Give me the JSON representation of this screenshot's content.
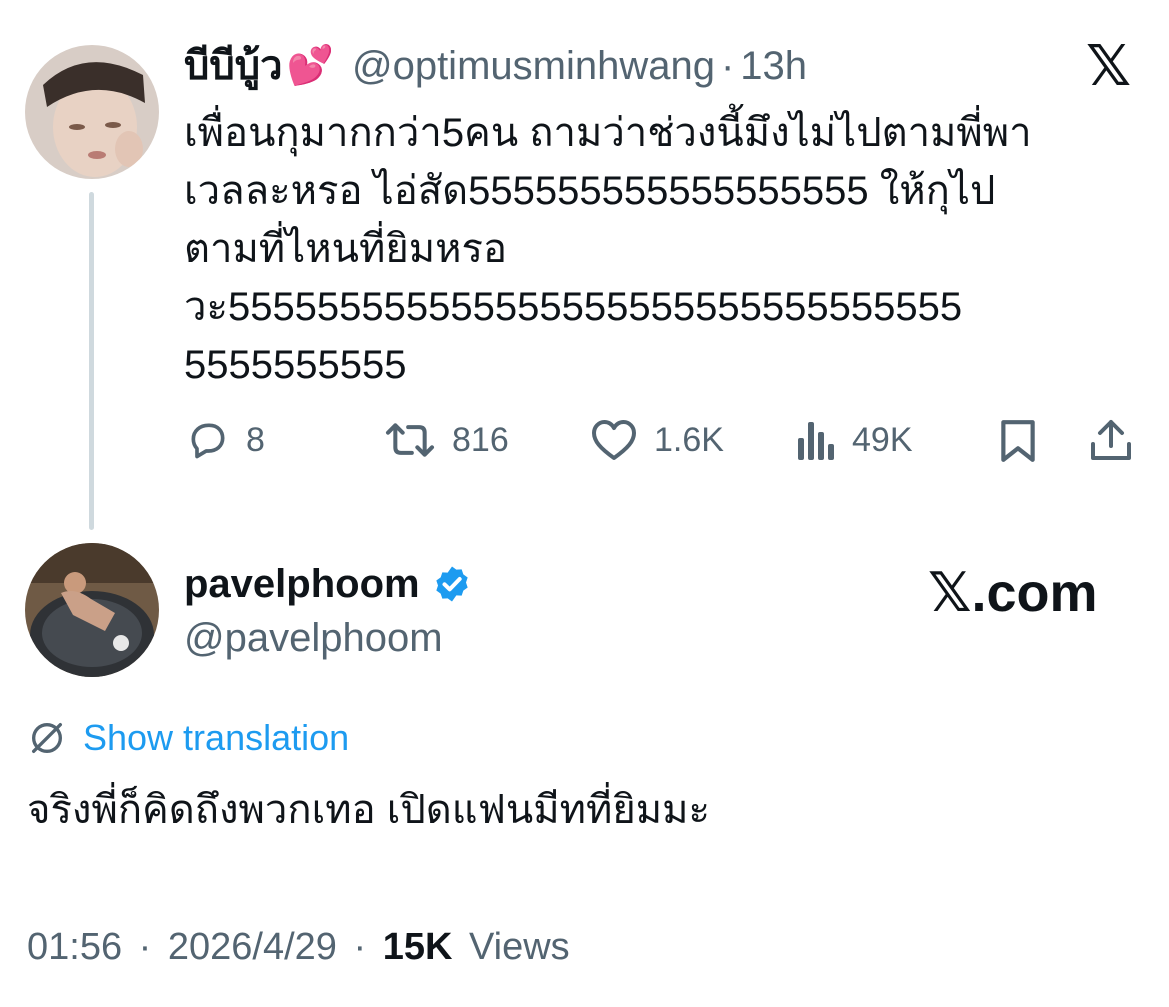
{
  "quoted_tweet": {
    "display_name": "บีบีบู้ว",
    "name_emoji": "💕",
    "handle": "@optimusminhwang",
    "separator": "·",
    "time": "13h",
    "x_logo": "𝕏",
    "text_lines": [
      "เพื่อนกุมากกว่า5คน ถามว่าช่วงนี้มึงไม่ไปตามพี่พา",
      "เวลละหรอ ไอ่สัด555555555555555555 ให้กุไป",
      "ตามที่ไหนที่ยิมหรอ",
      "วะ555555555555555555555555555555555",
      "5555555555"
    ],
    "actions": {
      "replies": "8",
      "reposts": "816",
      "likes": "1.6K",
      "views": "49K"
    },
    "icons": [
      "reply-icon",
      "repost-icon",
      "like-icon",
      "views-icon",
      "bookmark-icon",
      "share-icon"
    ]
  },
  "main_tweet": {
    "display_name": "pavelphoom",
    "handle": "@pavelphoom",
    "verified": true,
    "brand": "𝕏.com",
    "show_translation": "Show translation",
    "text": "จริงพี่ก็คิดถึงพวกเทอ เปิดแฟนมีทที่ยิมมะ",
    "time": "01:56",
    "date": "2026/4/29",
    "separator": "·",
    "views_count": "15K",
    "views_label": "Views"
  },
  "colors": {
    "text": "#0f1419",
    "secondary": "#536471",
    "link": "#1d9bf0",
    "verified": "#1d9bf0",
    "thread_line": "#cfd9de"
  }
}
